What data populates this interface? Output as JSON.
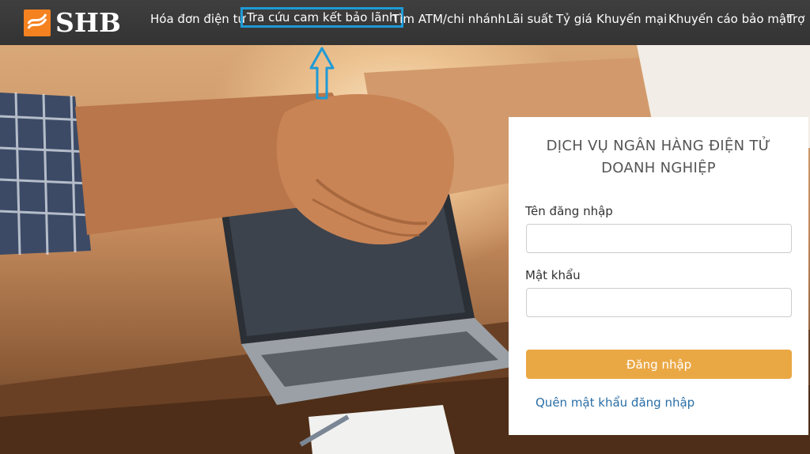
{
  "brand": {
    "name": "SHB",
    "accent": "#f58220"
  },
  "nav": {
    "items": [
      {
        "label": "Hóa đơn điện tử",
        "highlight": false
      },
      {
        "label": "Tra cứu cam kết bảo lãnh",
        "highlight": true
      },
      {
        "label": "Tìm ATM/chi nhánh",
        "highlight": false
      },
      {
        "label": "Lãi suất",
        "highlight": false
      },
      {
        "label": "Tỷ giá",
        "highlight": false
      },
      {
        "label": "Khuyến mại",
        "highlight": false
      },
      {
        "label": "Khuyến cáo bảo mật",
        "highlight": false
      },
      {
        "label": "Trợ",
        "highlight": false
      }
    ],
    "highlight_color": "#1e9ad6"
  },
  "login": {
    "title_line1": "DỊCH VỤ NGÂN HÀNG ĐIỆN TỬ",
    "title_line2": "DOANH NGHIỆP",
    "username_label": "Tên đăng nhập",
    "username_value": "",
    "password_label": "Mật khẩu",
    "password_value": "",
    "submit_label": "Đăng nhập",
    "forgot_label": "Quên mật khẩu đăng nhập",
    "button_color": "#eaa845"
  }
}
